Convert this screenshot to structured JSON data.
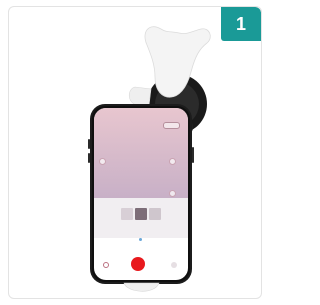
{
  "badge": {
    "number": "1"
  },
  "colors": {
    "badge_bg": "#1a9a97",
    "clip_white": "#f5f5f5",
    "lens_black": "#1a1a1a",
    "phone_frame": "#1c1c1c",
    "shutter_red": "#e8191d"
  },
  "product": {
    "description_icons": [
      "phone-icon",
      "macro-lens-clip-icon"
    ],
    "swatches": [
      "#d8cfd6",
      "#7d6d78",
      "#cfc6cd"
    ]
  }
}
